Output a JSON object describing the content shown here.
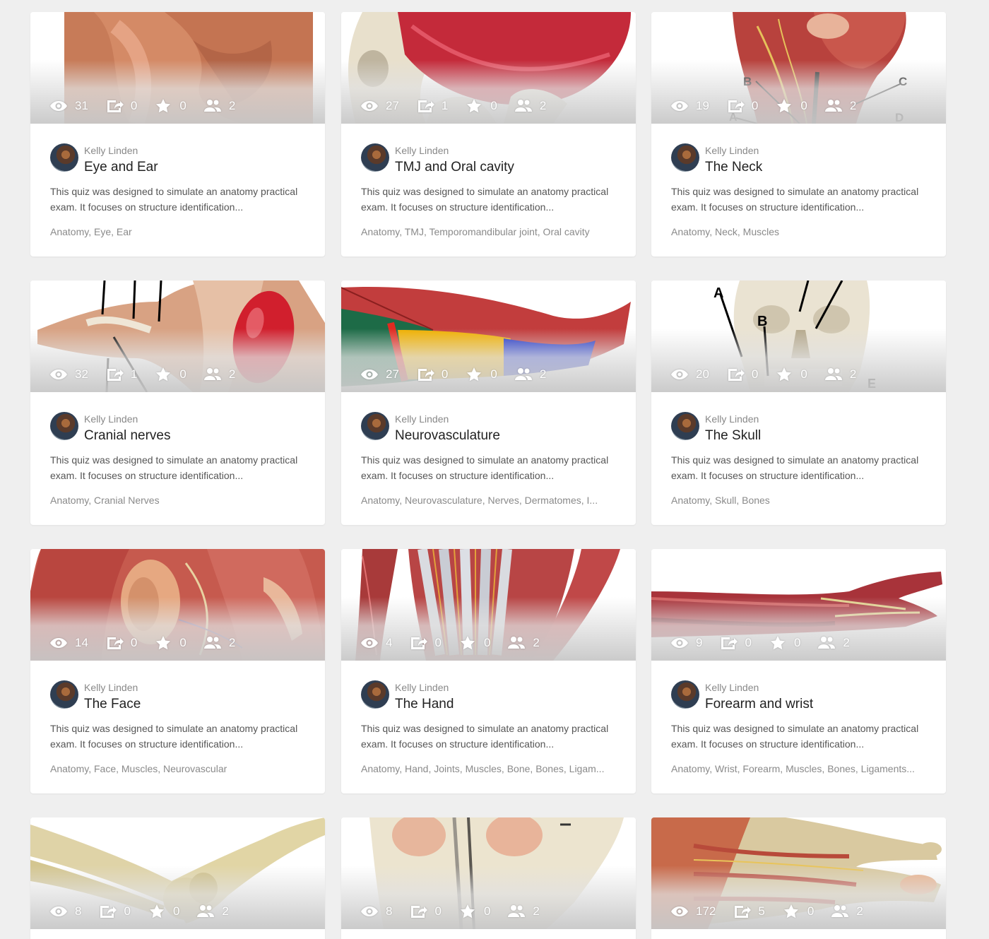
{
  "common": {
    "author": "Kelly Linden",
    "description": "This quiz was designed to simulate an anatomy practical exam. It focuses on structure identification..."
  },
  "colors": {
    "page_background": "#efefef",
    "card_background": "#ffffff",
    "title_text": "#222222",
    "meta_text": "#888888"
  },
  "cards": [
    {
      "title": "Eye and Ear",
      "tags": "Anatomy, Eye, Ear",
      "stats": {
        "views": "31",
        "shares": "0",
        "stars": "0",
        "members": "2"
      },
      "image": "close-up skin / ear"
    },
    {
      "title": "TMJ and Oral cavity",
      "tags": "Anatomy, TMJ, Temporomandibular joint, Oral cavity",
      "stats": {
        "views": "27",
        "shares": "1",
        "stars": "0",
        "members": "2"
      },
      "image": "skull with red muscle"
    },
    {
      "title": "The Neck",
      "tags": "Anatomy, Neck, Muscles",
      "stats": {
        "views": "19",
        "shares": "0",
        "stars": "0",
        "members": "2"
      },
      "image": "neck model with labels",
      "labels": [
        "A",
        "B",
        "C",
        "D"
      ]
    },
    {
      "title": "Cranial nerves",
      "tags": "Anatomy, Cranial Nerves",
      "stats": {
        "views": "32",
        "shares": "1",
        "stars": "0",
        "members": "2"
      },
      "image": "brainstem model with arrows"
    },
    {
      "title": "Neurovasculature",
      "tags": "Anatomy, Neurovasculature, Nerves, Dermatomes, I...",
      "stats": {
        "views": "27",
        "shares": "0",
        "stars": "0",
        "members": "2"
      },
      "image": "colored dermatome arm"
    },
    {
      "title": "The Skull",
      "tags": "Anatomy, Skull, Bones",
      "stats": {
        "views": "20",
        "shares": "0",
        "stars": "0",
        "members": "2"
      },
      "image": "skull with labels",
      "labels": [
        "A",
        "B",
        "E"
      ]
    },
    {
      "title": "The Face",
      "tags": "Anatomy, Face, Muscles, Neurovascular",
      "stats": {
        "views": "14",
        "shares": "0",
        "stars": "0",
        "members": "2"
      },
      "image": "face muscle model"
    },
    {
      "title": "The Hand",
      "tags": "Anatomy, Hand, Joints, Muscles, Bone, Bones, Ligam...",
      "stats": {
        "views": "4",
        "shares": "0",
        "stars": "0",
        "members": "2"
      },
      "image": "hand tendons model"
    },
    {
      "title": "Forearm and wrist",
      "tags": "Anatomy, Wrist, Forearm, Muscles, Bones, Ligaments...",
      "stats": {
        "views": "9",
        "shares": "0",
        "stars": "0",
        "members": "2"
      },
      "image": "forearm muscle model"
    },
    {
      "stats": {
        "views": "8",
        "shares": "0",
        "stars": "0",
        "members": "2"
      },
      "image": "elbow bones"
    },
    {
      "stats": {
        "views": "8",
        "shares": "0",
        "stars": "0",
        "members": "2"
      },
      "image": "pelvis / hip model"
    },
    {
      "stats": {
        "views": "172",
        "shares": "5",
        "stars": "0",
        "members": "2"
      },
      "image": "hand dorsal muscle model"
    }
  ]
}
